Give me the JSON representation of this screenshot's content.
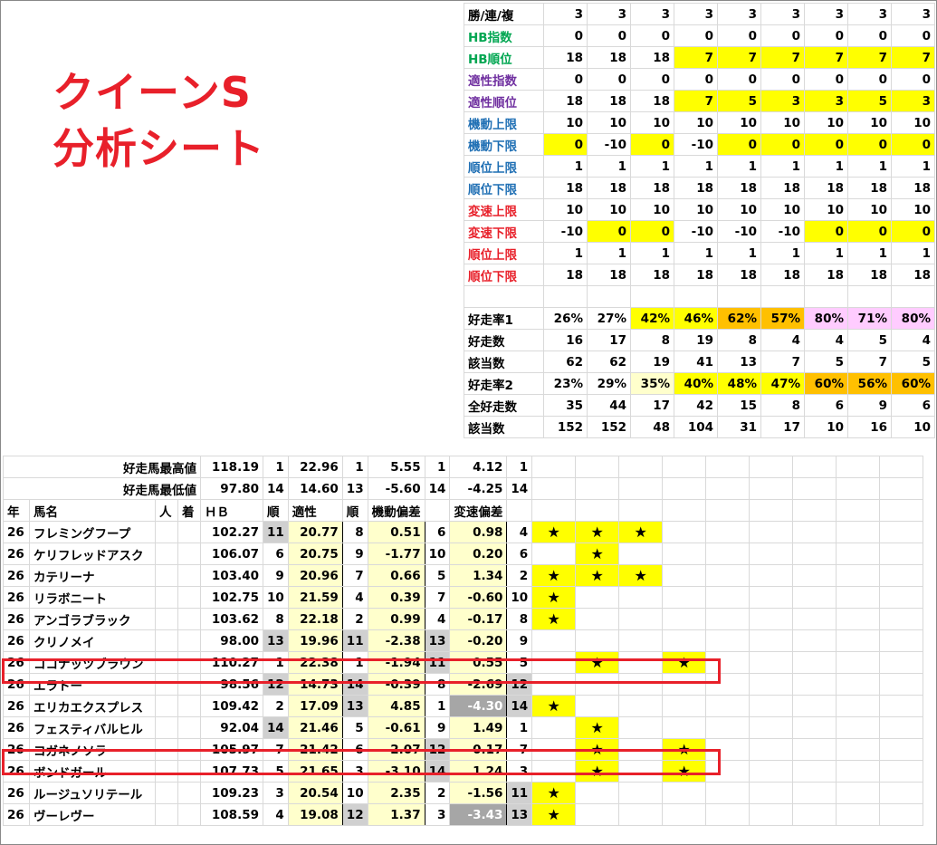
{
  "title": {
    "line1": "クイーンS",
    "line2": "分析シート"
  },
  "criteria": [
    {
      "label": "勝/連/複",
      "cls": "",
      "values": [
        "3",
        "3",
        "3",
        "3",
        "3",
        "3",
        "3",
        "3",
        "3"
      ],
      "hl": [
        "",
        "",
        "",
        "",
        "",
        "",
        "",
        "",
        ""
      ]
    },
    {
      "label": "HB指数",
      "cls": "green",
      "values": [
        "0",
        "0",
        "0",
        "0",
        "0",
        "0",
        "0",
        "0",
        "0"
      ],
      "hl": [
        "",
        "",
        "",
        "",
        "",
        "",
        "",
        "",
        ""
      ]
    },
    {
      "label": "HB順位",
      "cls": "green",
      "values": [
        "18",
        "18",
        "18",
        "7",
        "7",
        "7",
        "7",
        "7",
        "7"
      ],
      "hl": [
        "",
        "",
        "",
        "y",
        "y",
        "y",
        "y",
        "y",
        "y"
      ]
    },
    {
      "label": "適性指数",
      "cls": "purple",
      "values": [
        "0",
        "0",
        "0",
        "0",
        "0",
        "0",
        "0",
        "0",
        "0"
      ],
      "hl": [
        "",
        "",
        "",
        "",
        "",
        "",
        "",
        "",
        ""
      ]
    },
    {
      "label": "適性順位",
      "cls": "purple",
      "values": [
        "18",
        "18",
        "18",
        "7",
        "5",
        "3",
        "3",
        "5",
        "3"
      ],
      "hl": [
        "",
        "",
        "",
        "y",
        "y",
        "y",
        "y",
        "y",
        "y"
      ]
    },
    {
      "label": "機動上限",
      "cls": "blue",
      "values": [
        "10",
        "10",
        "10",
        "10",
        "10",
        "10",
        "10",
        "10",
        "10"
      ],
      "hl": [
        "",
        "",
        "",
        "",
        "",
        "",
        "",
        "",
        ""
      ]
    },
    {
      "label": "機動下限",
      "cls": "blue",
      "values": [
        "0",
        "-10",
        "0",
        "-10",
        "0",
        "0",
        "0",
        "0",
        "0"
      ],
      "hl": [
        "y",
        "",
        "y",
        "",
        "y",
        "y",
        "y",
        "y",
        "y"
      ]
    },
    {
      "label": "順位上限",
      "cls": "blue",
      "values": [
        "1",
        "1",
        "1",
        "1",
        "1",
        "1",
        "1",
        "1",
        "1"
      ],
      "hl": [
        "",
        "",
        "",
        "",
        "",
        "",
        "",
        "",
        ""
      ]
    },
    {
      "label": "順位下限",
      "cls": "blue",
      "values": [
        "18",
        "18",
        "18",
        "18",
        "18",
        "18",
        "18",
        "18",
        "18"
      ],
      "hl": [
        "",
        "",
        "",
        "",
        "",
        "",
        "",
        "",
        ""
      ]
    },
    {
      "label": "変速上限",
      "cls": "red",
      "values": [
        "10",
        "10",
        "10",
        "10",
        "10",
        "10",
        "10",
        "10",
        "10"
      ],
      "hl": [
        "",
        "",
        "",
        "",
        "",
        "",
        "",
        "",
        ""
      ]
    },
    {
      "label": "変速下限",
      "cls": "red",
      "values": [
        "-10",
        "0",
        "0",
        "-10",
        "-10",
        "-10",
        "0",
        "0",
        "0"
      ],
      "hl": [
        "",
        "y",
        "y",
        "",
        "",
        "",
        "y",
        "y",
        "y"
      ]
    },
    {
      "label": "順位上限",
      "cls": "red",
      "values": [
        "1",
        "1",
        "1",
        "1",
        "1",
        "1",
        "1",
        "1",
        "1"
      ],
      "hl": [
        "",
        "",
        "",
        "",
        "",
        "",
        "",
        "",
        ""
      ]
    },
    {
      "label": "順位下限",
      "cls": "red",
      "values": [
        "18",
        "18",
        "18",
        "18",
        "18",
        "18",
        "18",
        "18",
        "18"
      ],
      "hl": [
        "",
        "",
        "",
        "",
        "",
        "",
        "",
        "",
        ""
      ]
    }
  ],
  "stats": [
    {
      "label": "好走率1",
      "values": [
        "26%",
        "27%",
        "42%",
        "46%",
        "62%",
        "57%",
        "80%",
        "71%",
        "80%"
      ],
      "hl": [
        "",
        "",
        "y",
        "y",
        "o",
        "o",
        "p",
        "p",
        "p"
      ]
    },
    {
      "label": "好走数",
      "values": [
        "16",
        "17",
        "8",
        "19",
        "8",
        "4",
        "4",
        "5",
        "4"
      ],
      "hl": [
        "",
        "",
        "",
        "",
        "",
        "",
        "",
        "",
        ""
      ]
    },
    {
      "label": "該当数",
      "values": [
        "62",
        "62",
        "19",
        "41",
        "13",
        "7",
        "5",
        "7",
        "5"
      ],
      "hl": [
        "",
        "",
        "",
        "",
        "",
        "",
        "",
        "",
        ""
      ]
    },
    {
      "label": "好走率2",
      "values": [
        "23%",
        "29%",
        "35%",
        "40%",
        "48%",
        "47%",
        "60%",
        "56%",
        "60%"
      ],
      "hl": [
        "",
        "",
        "ly",
        "y",
        "y",
        "y",
        "o",
        "o",
        "o"
      ]
    },
    {
      "label": "全好走数",
      "values": [
        "35",
        "44",
        "17",
        "42",
        "15",
        "8",
        "6",
        "9",
        "6"
      ],
      "hl": [
        "",
        "",
        "",
        "",
        "",
        "",
        "",
        "",
        ""
      ]
    },
    {
      "label": "該当数",
      "values": [
        "152",
        "152",
        "48",
        "104",
        "31",
        "17",
        "10",
        "16",
        "10"
      ],
      "hl": [
        "",
        "",
        "",
        "",
        "",
        "",
        "",
        "",
        ""
      ]
    }
  ],
  "summary": {
    "max_label": "好走馬最高値",
    "max": [
      "118.19",
      "1",
      "22.96",
      "1",
      "5.55",
      "1",
      "4.12",
      "1"
    ],
    "min_label": "好走馬最低値",
    "min": [
      "97.80",
      "14",
      "14.60",
      "13",
      "-5.60",
      "14",
      "-4.25",
      "14"
    ]
  },
  "headers": [
    "年",
    "馬名",
    "人",
    "着",
    "ＨＢ",
    "順",
    "適性",
    "順",
    "機動偏差",
    "",
    "変速偏差",
    ""
  ],
  "horses": [
    {
      "year": "26",
      "name": "フレミングフープ",
      "hb": "102.27",
      "hbr": "11",
      "apt": "20.77",
      "aptr": "8",
      "kid": "0.51",
      "kidr": "6",
      "hen": "0.98",
      "henr": "4",
      "stars": [
        "★",
        "★",
        "★",
        "",
        "",
        ""
      ]
    },
    {
      "year": "26",
      "name": "ケリフレッドアスク",
      "hb": "106.07",
      "hbr": "6",
      "apt": "20.75",
      "aptr": "9",
      "kid": "-1.77",
      "kidr": "10",
      "hen": "0.20",
      "henr": "6",
      "stars": [
        "",
        "★",
        "",
        "",
        "",
        ""
      ]
    },
    {
      "year": "26",
      "name": "カテリーナ",
      "hb": "103.40",
      "hbr": "9",
      "apt": "20.96",
      "aptr": "7",
      "kid": "0.66",
      "kidr": "5",
      "hen": "1.34",
      "henr": "2",
      "stars": [
        "★",
        "★",
        "★",
        "",
        "",
        ""
      ]
    },
    {
      "year": "26",
      "name": "リラボニート",
      "hb": "102.75",
      "hbr": "10",
      "apt": "21.59",
      "aptr": "4",
      "kid": "0.39",
      "kidr": "7",
      "hen": "-0.60",
      "henr": "10",
      "stars": [
        "★",
        "",
        "",
        "",
        "",
        ""
      ]
    },
    {
      "year": "26",
      "name": "アンゴラブラック",
      "hb": "103.62",
      "hbr": "8",
      "apt": "22.18",
      "aptr": "2",
      "kid": "0.99",
      "kidr": "4",
      "hen": "-0.17",
      "henr": "8",
      "stars": [
        "★",
        "",
        "",
        "",
        "",
        ""
      ]
    },
    {
      "year": "26",
      "name": "クリノメイ",
      "hb": "98.00",
      "hbr": "13",
      "apt": "19.96",
      "aptr": "11",
      "kid": "-2.38",
      "kidr": "13",
      "hen": "-0.20",
      "henr": "9",
      "stars": [
        "",
        "",
        "",
        "",
        "",
        ""
      ]
    },
    {
      "year": "26",
      "name": "ココナッツブラウン",
      "hb": "110.27",
      "hbr": "1",
      "apt": "22.38",
      "aptr": "1",
      "kid": "-1.94",
      "kidr": "11",
      "hen": "0.55",
      "henr": "5",
      "stars": [
        "",
        "★",
        "",
        "★",
        "",
        ""
      ]
    },
    {
      "year": "26",
      "name": "エラトー",
      "hb": "98.56",
      "hbr": "12",
      "apt": "14.73",
      "aptr": "14",
      "kid": "-0.39",
      "kidr": "8",
      "hen": "-2.69",
      "henr": "12",
      "stars": [
        "",
        "",
        "",
        "",
        "",
        ""
      ]
    },
    {
      "year": "26",
      "name": "エリカエクスプレス",
      "hb": "109.42",
      "hbr": "2",
      "apt": "17.09",
      "aptr": "13",
      "kid": "4.85",
      "kidr": "1",
      "hen": "-4.30",
      "henr": "14",
      "stars": [
        "★",
        "",
        "",
        "",
        "",
        ""
      ]
    },
    {
      "year": "26",
      "name": "フェスティバルヒル",
      "hb": "92.04",
      "hbr": "14",
      "apt": "21.46",
      "aptr": "5",
      "kid": "-0.61",
      "kidr": "9",
      "hen": "1.49",
      "henr": "1",
      "stars": [
        "",
        "★",
        "",
        "",
        "",
        ""
      ]
    },
    {
      "year": "26",
      "name": "コガネノソラ",
      "hb": "105.97",
      "hbr": "7",
      "apt": "21.42",
      "aptr": "6",
      "kid": "-2.07",
      "kidr": "12",
      "hen": "0.17",
      "henr": "7",
      "stars": [
        "",
        "★",
        "",
        "★",
        "",
        ""
      ]
    },
    {
      "year": "26",
      "name": "ボンドガール",
      "hb": "107.73",
      "hbr": "5",
      "apt": "21.65",
      "aptr": "3",
      "kid": "-3.10",
      "kidr": "14",
      "hen": "1.24",
      "henr": "3",
      "stars": [
        "",
        "★",
        "",
        "★",
        "",
        ""
      ]
    },
    {
      "year": "26",
      "name": "ルージュソリテール",
      "hb": "109.23",
      "hbr": "3",
      "apt": "20.54",
      "aptr": "10",
      "kid": "2.35",
      "kidr": "2",
      "hen": "-1.56",
      "henr": "11",
      "stars": [
        "★",
        "",
        "",
        "",
        "",
        ""
      ]
    },
    {
      "year": "26",
      "name": "ヴーレヴー",
      "hb": "108.59",
      "hbr": "4",
      "apt": "19.08",
      "aptr": "12",
      "kid": "1.37",
      "kidr": "3",
      "hen": "-3.43",
      "henr": "13",
      "stars": [
        "★",
        "",
        "",
        "",
        "",
        ""
      ]
    }
  ],
  "colors": {
    "yellow": "#ffff00",
    "orange": "#ffc000",
    "pink": "#ffccff",
    "red": "#e8202a"
  }
}
